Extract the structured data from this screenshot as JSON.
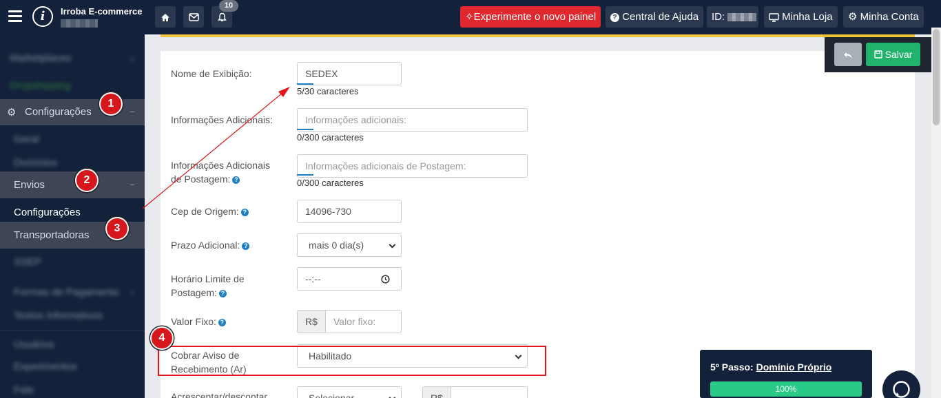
{
  "topbar": {
    "brand_name": "Irroba E-commerce",
    "home_icon": "home-icon",
    "mail_icon": "envelope-icon",
    "notifications_count": "10",
    "new_panel_button": "✧Experimente o novo painel",
    "help_button": "Central de Ajuda",
    "id_label": "ID:",
    "my_store_button": "Minha Loja",
    "my_account_button": "Minha Conta"
  },
  "sidebar": {
    "settings_label": "Configurações",
    "shipping_label": "Envios",
    "shipping_settings_label": "Configurações",
    "carriers_label": "Transportadoras",
    "blurred": [
      "Marketplaces",
      "Dropshipping",
      "Geral",
      "Domínios",
      "SSEP",
      "Formas de Pagamento",
      "Textos Informativos",
      "Usuários",
      "Experimentos",
      "Fale"
    ]
  },
  "toolbar": {
    "save_label": "Salvar"
  },
  "form": {
    "display_name_label": "Nome de Exibição:",
    "display_name_value": "SEDEX",
    "display_name_counter": "5/30 caracteres",
    "additional_info_label": "Informações Adicionais:",
    "additional_info_placeholder": "Informações adicionais:",
    "additional_info_counter": "0/300 caracteres",
    "posting_info_label_1": "Informações Adicionais",
    "posting_info_label_2": "de Postagem:",
    "posting_info_placeholder": "Informações adicionais de Postagem:",
    "posting_info_counter": "0/300 caracteres",
    "origin_cep_label": "Cep de Origem:",
    "origin_cep_value": "14096-730",
    "additional_days_label": "Prazo Adicional:",
    "additional_days_value": "mais 0 dia(s)",
    "time_limit_label_1": "Horário Limite de",
    "time_limit_label_2": "Postagem:",
    "time_limit_value": "--:--",
    "fixed_value_label": "Valor Fixo:",
    "currency": "R$",
    "fixed_value_placeholder": "Valor fixo:",
    "ar_label_1": "Cobrar Aviso de",
    "ar_label_2": "Recebimento (Ar)",
    "ar_value": "Habilitado",
    "add_discount_label": "Acrescentar/descontar",
    "add_discount_value": "Selecionar"
  },
  "annotations": [
    "1",
    "2",
    "3",
    "4"
  ],
  "step_widget": {
    "step_prefix": "5º Passo:",
    "step_link": "Domínio Próprio",
    "progress_percent": "100%"
  },
  "colors": {
    "topbar": "#13213a",
    "accent_red": "#e0282e",
    "save_green": "#21b26b",
    "progress_green": "#29c987",
    "focus_blue": "#1e7fc6"
  }
}
